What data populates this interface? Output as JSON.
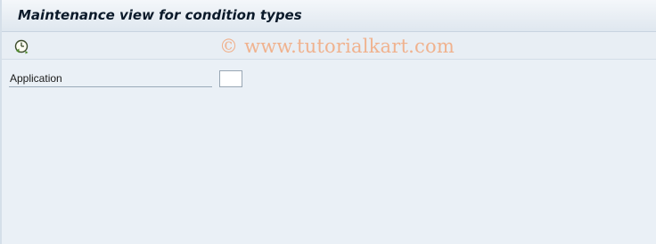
{
  "window": {
    "title": "Maintenance view for condition types"
  },
  "toolbar": {
    "execute_icon": "execute-clock-icon"
  },
  "watermark": "© www.tutorialkart.com",
  "form": {
    "application": {
      "label": "Application",
      "value": "",
      "placeholder": ""
    }
  }
}
